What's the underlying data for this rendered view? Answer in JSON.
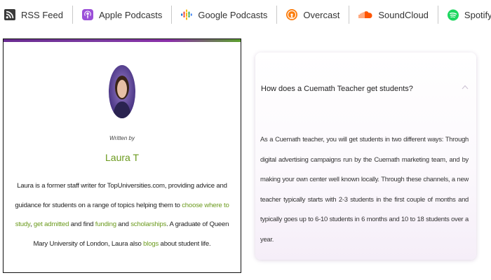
{
  "podcast_links": [
    {
      "label": "RSS Feed",
      "icon": "rss-icon"
    },
    {
      "label": "Apple Podcasts",
      "icon": "apple-podcasts-icon"
    },
    {
      "label": "Google Podcasts",
      "icon": "google-podcasts-icon"
    },
    {
      "label": "Overcast",
      "icon": "overcast-icon"
    },
    {
      "label": "SoundCloud",
      "icon": "soundcloud-icon"
    },
    {
      "label": "Spotify",
      "icon": "spotify-icon"
    }
  ],
  "author": {
    "written_by": "Written by",
    "name": "Laura T",
    "bio": {
      "part1": "Laura is a former staff writer for TopUniversities.com, providing advice and guidance for students on a range of topics helping them to ",
      "link1": "choose where to study",
      "sep1": ", ",
      "link2": "get admitted",
      "part2": " and find ",
      "link3": "funding",
      "part3": " and ",
      "link4": "scholarships",
      "part4": ". A graduate of Queen Mary University of London, Laura also ",
      "link5": "blogs",
      "part5": " about student life."
    }
  },
  "faq": {
    "question": "How does a Cuemath Teacher get students?",
    "toggle_icon": "chevron-up-icon",
    "answer": "As a Cuemath teacher, you will get students in two different ways: Through digital advertising campaigns run by the Cuemath marketing team, and by making your own center well known locally. Through these channels, a new teacher typically starts with 2-3 students in the first couple of months and typically goes up to 6-10 students in 6 months and 10 to 18 students over a year."
  },
  "colors": {
    "accent_green": "#6b9a1d",
    "brand_purple": "#6a2c91"
  }
}
